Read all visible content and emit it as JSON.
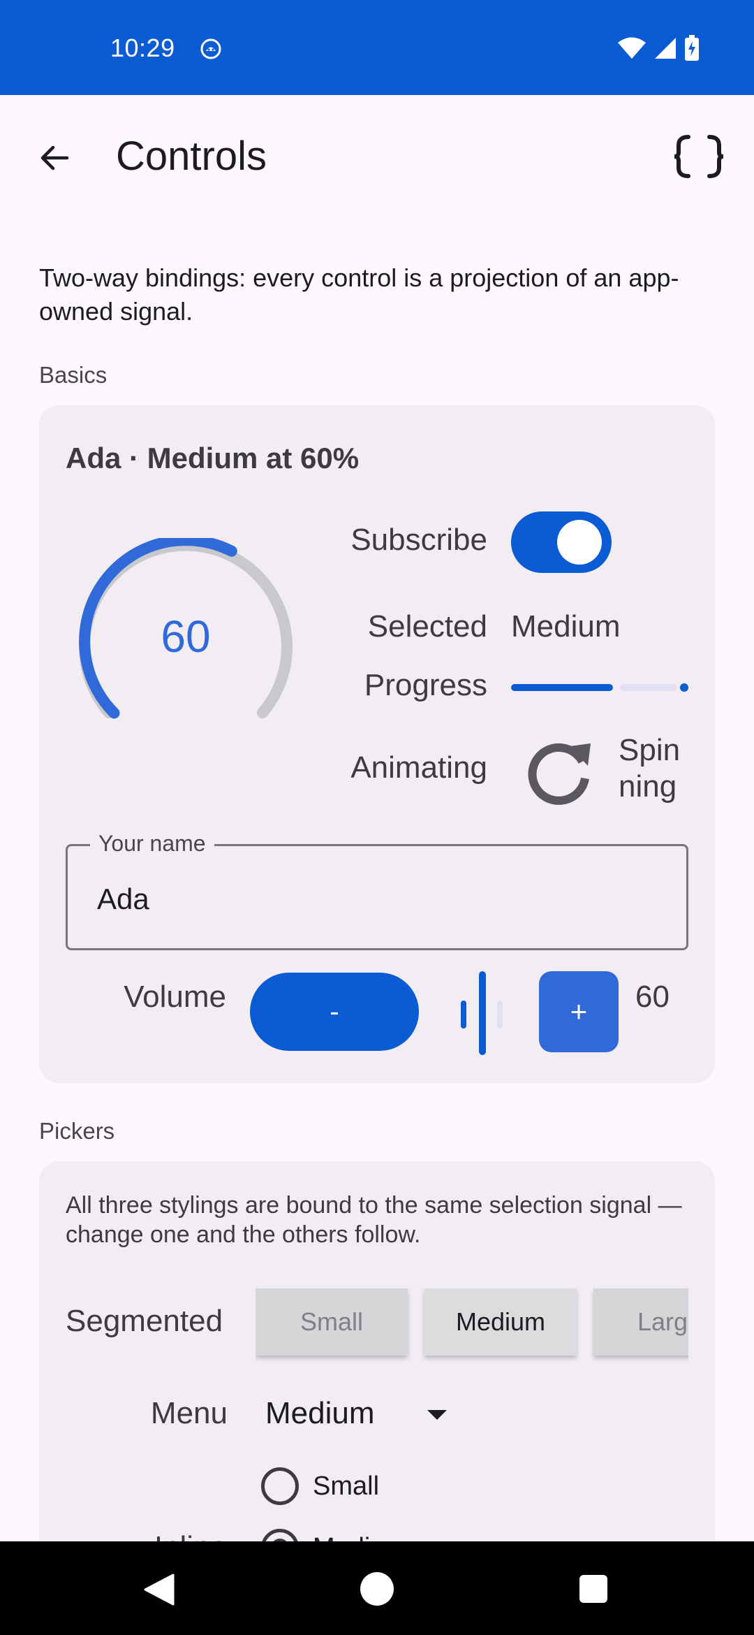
{
  "status_bar": {
    "time": "10:29"
  },
  "app_bar": {
    "title": "Controls"
  },
  "intro": "Two-way bindings: every control is a projection of an app-owned signal.",
  "basics": {
    "section_label": "Basics",
    "title": "Ada · Medium at 60%",
    "gauge": {
      "value": "60",
      "fraction": 0.6
    },
    "subscribe": {
      "label": "Subscribe",
      "on": true
    },
    "selected": {
      "label": "Selected",
      "value": "Medium"
    },
    "progress": {
      "label": "Progress",
      "fraction": 0.6
    },
    "animating": {
      "label": "Animating",
      "status": "Spin ning"
    },
    "name_field": {
      "label": "Your name",
      "value": "Ada"
    },
    "volume": {
      "label": "Volume",
      "minus": "-",
      "plus": "+",
      "value": "60",
      "fraction": 0.6
    }
  },
  "pickers": {
    "section_label": "Pickers",
    "description": "All three stylings are bound to the same selection signal — change one and the others follow.",
    "segmented": {
      "label": "Segmented",
      "options": [
        "Small",
        "Medium",
        "Large"
      ],
      "selected": "Medium"
    },
    "menu": {
      "label": "Menu",
      "value": "Medium"
    },
    "inline": {
      "label": "Inline",
      "options": [
        "Small",
        "Medium"
      ],
      "selected": "Medium"
    }
  },
  "colors": {
    "primary": "#0b5bd3",
    "accent": "#2f6ad8",
    "card": "#f1edf3",
    "background": "#fdf8fd"
  }
}
